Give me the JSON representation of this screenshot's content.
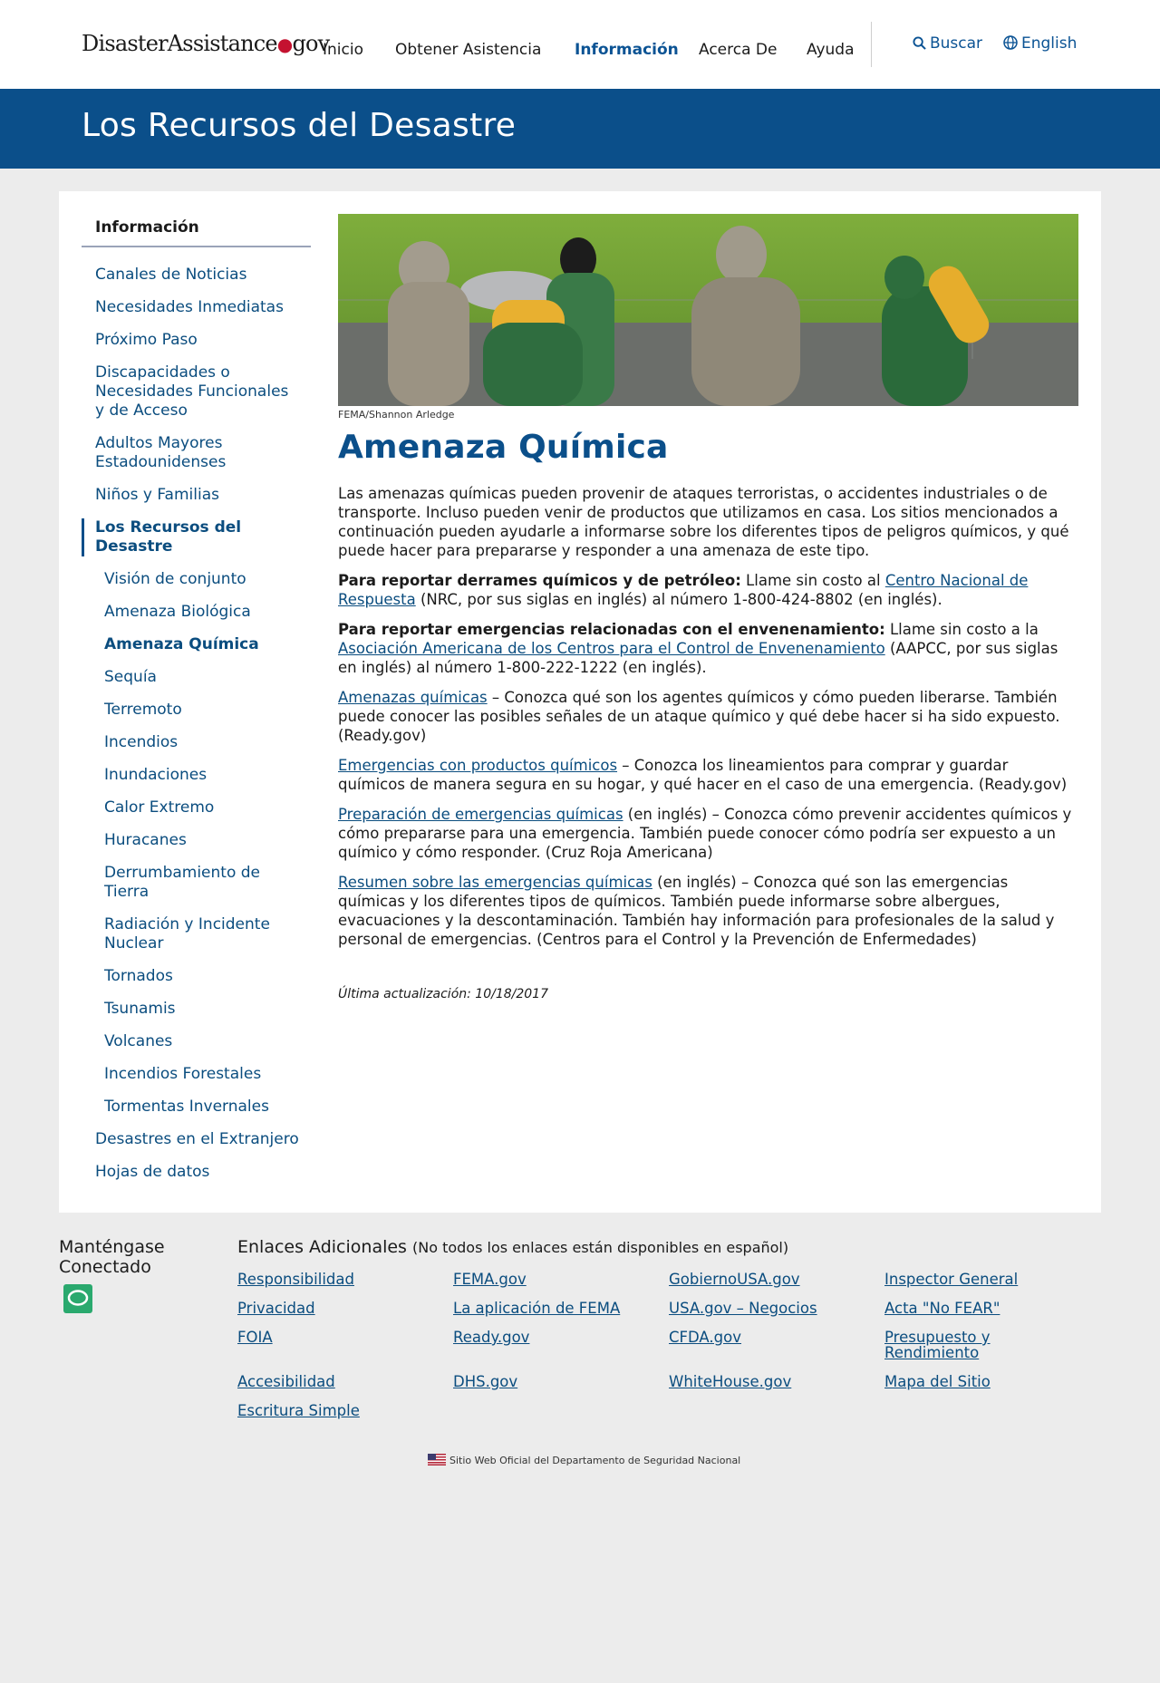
{
  "header": {
    "logo_main": "DisasterAssistance",
    "logo_dot": "●",
    "logo_suffix": "gov",
    "nav": [
      {
        "label": "Inicio"
      },
      {
        "label": "Obtener Asistencia"
      },
      {
        "label": "Información"
      },
      {
        "label": "Acerca De"
      },
      {
        "label": "Ayuda"
      }
    ],
    "search_label": "Buscar",
    "language_label": "English"
  },
  "banner": {
    "title": "Los Recursos del Desastre"
  },
  "sidebar": {
    "heading": "Información",
    "items": [
      "Canales de Noticias",
      "Necesidades Inmediatas",
      "Próximo Paso",
      "Discapacidades o Necesidades Funcionales y de Acceso",
      "Adultos Mayores Estadounidenses",
      "Niños y Familias"
    ],
    "current_section": "Los Recursos del Desastre",
    "sub_items": [
      "Visión de conjunto",
      "Amenaza Biológica",
      "Amenaza Química",
      "Sequía",
      "Terremoto",
      "Incendios",
      "Inundaciones",
      "Calor Extremo",
      "Huracanes",
      "Derrumbamiento de Tierra",
      "Radiación y Incidente Nuclear",
      "Tornados",
      "Tsunamis",
      "Volcanes",
      "Incendios Forestales",
      "Tormentas Invernales"
    ],
    "after_items": [
      "Desastres en el Extranjero",
      "Hojas de datos"
    ]
  },
  "content": {
    "image_credit": "FEMA/Shannon Arledge",
    "title": "Amenaza Química",
    "intro": "Las amenazas químicas pueden provenir de ataques terroristas, o accidentes industriales o de transporte. Incluso pueden venir de productos que utilizamos en casa. Los sitios mencionados a continuación pueden ayudarle a informarse sobre los diferentes tipos de peligros químicos, y qué puede hacer para prepararse y responder a una amenaza de este tipo.",
    "report_spill": {
      "lead": "Para reportar derrames químicos y de petróleo:",
      "pre": " Llame sin costo al ",
      "link": "Centro Nacional de Respuesta",
      "post": " (NRC, por sus siglas en inglés) al número 1-800-424-8802 (en inglés)."
    },
    "report_poison": {
      "lead": "Para reportar emergencias relacionadas con el envenenamiento:",
      "pre": " Llame sin costo a la ",
      "link": "Asociación Americana de los Centros para el Control de Envenenamiento",
      "post": " (AAPCC, por sus siglas en inglés) al número 1-800-222-1222 (en inglés)."
    },
    "resources": [
      {
        "link": "Amenazas químicas",
        "text": " – Conozca qué son los agentes químicos y cómo pueden liberarse. También puede conocer las posibles señales de un ataque químico y qué debe hacer si ha sido expuesto. (Ready.gov)"
      },
      {
        "link": "Emergencias con productos químicos",
        "text": " – Conozca los lineamientos para comprar y guardar químicos de manera segura en su hogar, y qué hacer en el caso de una emergencia. (Ready.gov)"
      },
      {
        "link": "Preparación de emergencias químicas",
        "text": " (en inglés) – Conozca cómo prevenir accidentes químicos y cómo prepararse para una emergencia. También puede conocer cómo podría ser expuesto a un químico y cómo responder. (Cruz Roja Americana)"
      },
      {
        "link": "Resumen sobre las emergencias químicas",
        "text": " (en inglés) – Conozca qué son las emergencias químicas y los diferentes tipos de químicos. También puede informarse sobre albergues, evacuaciones y la descontaminación. También hay información para profesionales de la salud y personal de emergencias. (Centros para el Control y la Prevención de Enfermedades)"
      }
    ],
    "last_updated": "Última actualización: 10/18/2017"
  },
  "footer": {
    "stay_connected": "Manténgase Conectado",
    "links_title": "Enlaces Adicionales",
    "links_note": "(No todos los enlaces están disponibles en español)",
    "links": [
      "Responsibilidad",
      "FEMA.gov",
      "GobiernoUSA.gov",
      "Inspector General",
      "Privacidad",
      "La aplicación de FEMA",
      "USA.gov – Negocios",
      "Acta \"No FEAR\"",
      "FOIA",
      "Ready.gov",
      "CFDA.gov",
      "Presupuesto y Rendimiento",
      "Accesibilidad",
      "DHS.gov",
      "WhiteHouse.gov",
      "Mapa del Sitio",
      "Escritura Simple"
    ],
    "official": "Sitio Web Oficial del Departamento de Seguridad Nacional"
  }
}
